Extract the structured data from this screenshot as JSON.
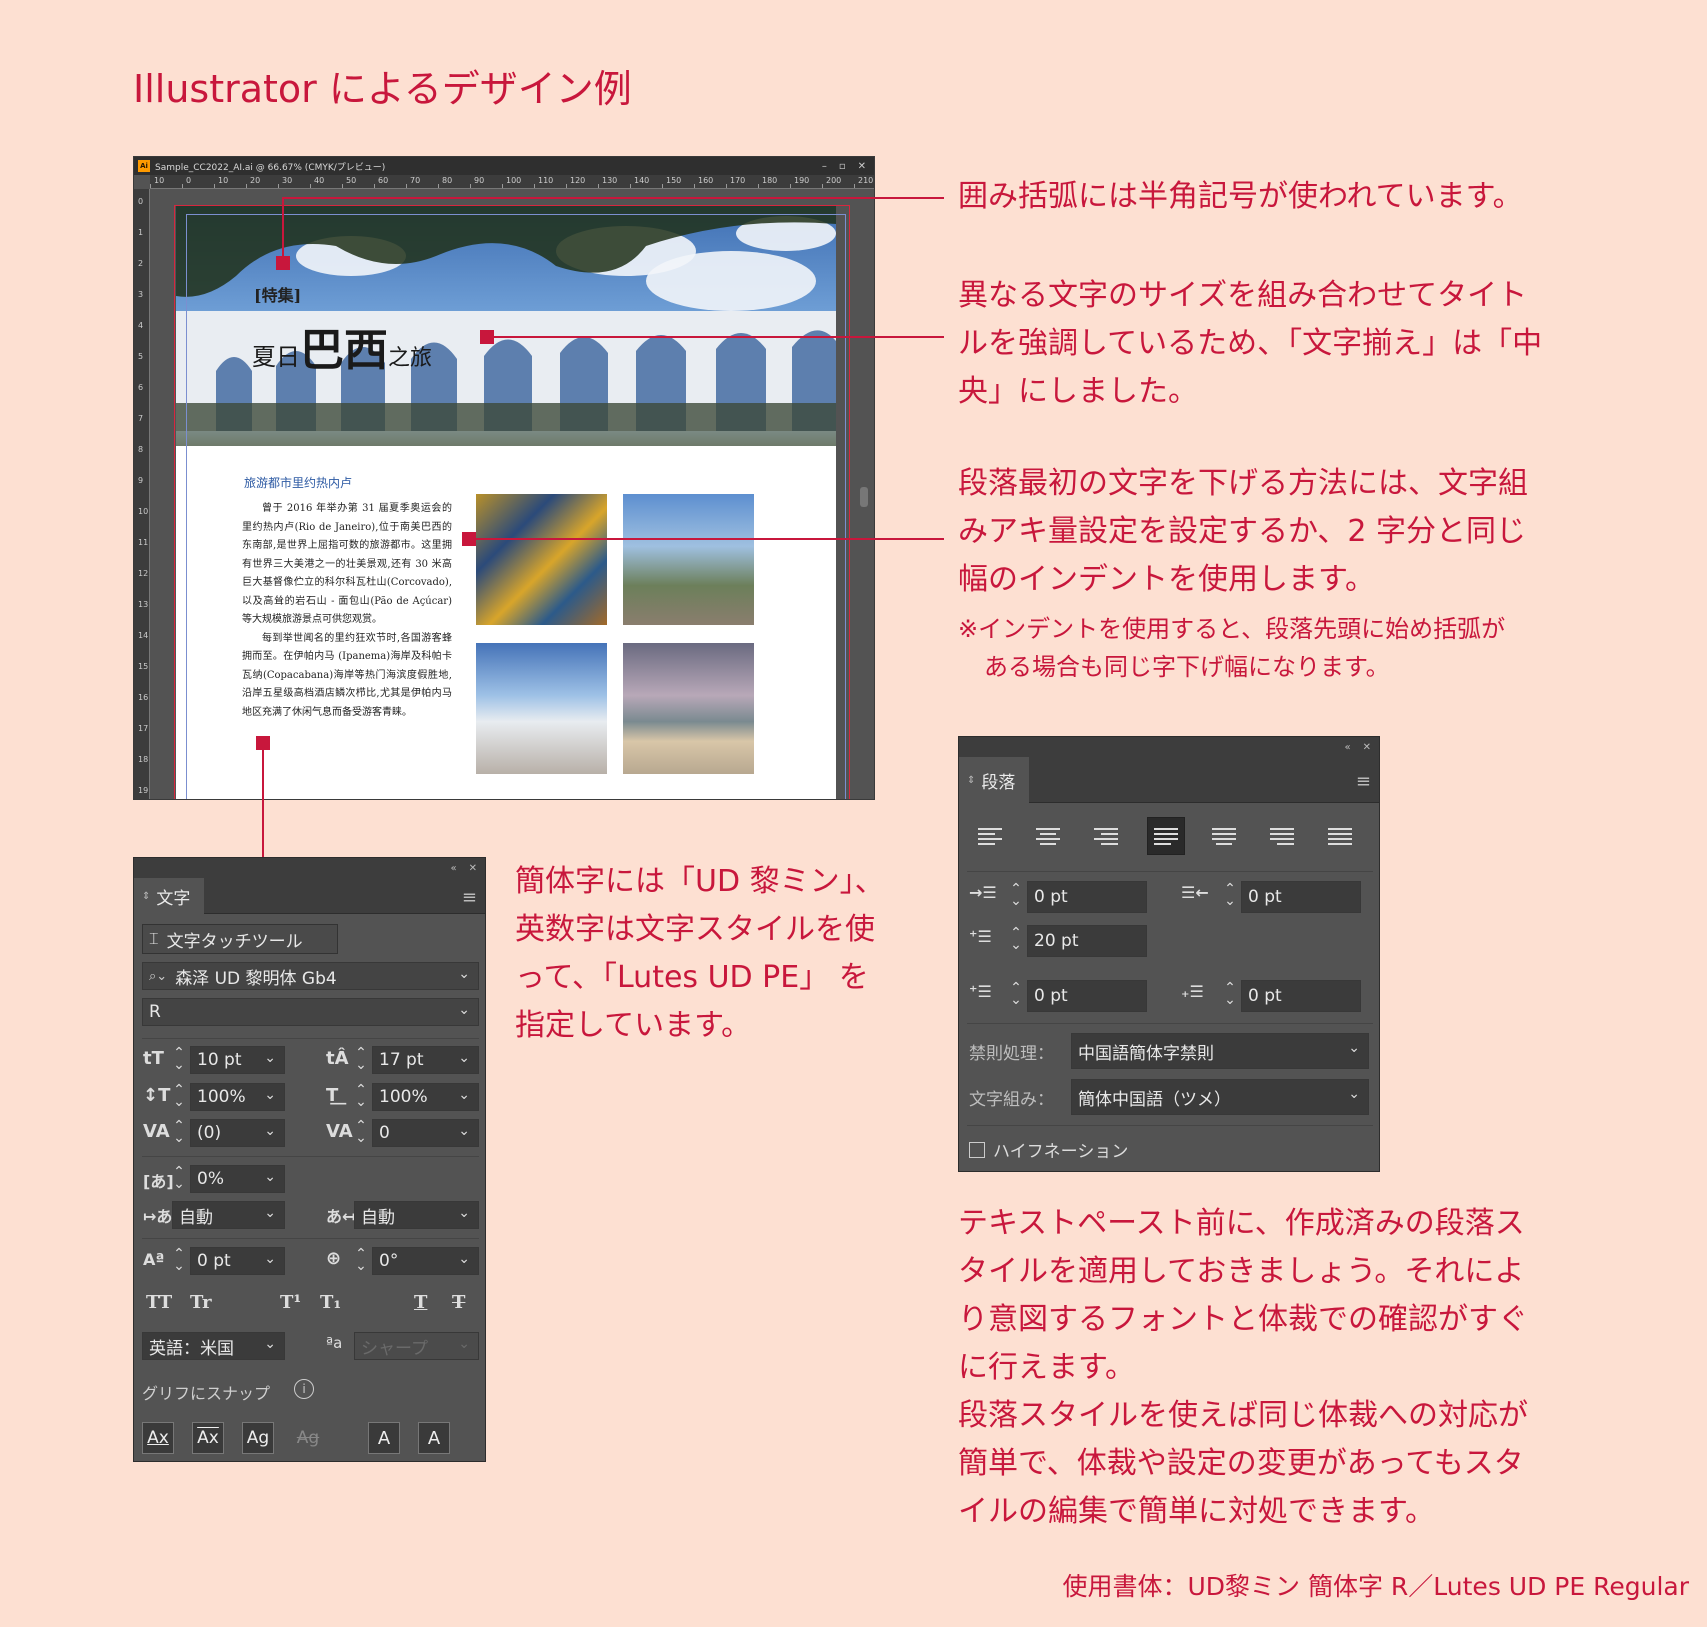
{
  "page": {
    "title": "Illustrator によるデザイン例",
    "footer": "使用書体：UD黎ミン 簡体字 R／Lutes UD PE Regular"
  },
  "annotations": {
    "brackets": "囲み括弧には半角記号が使われています。",
    "alignment": [
      "異なる文字のサイズを組み合わせてタイト",
      "ルを強調しているため、「文字揃え」は「中",
      "央」にしました。"
    ],
    "indent": [
      "段落最初の文字を下げる方法には、文字組",
      "みアキ量設定を設定するか、2 字分と同じ",
      "幅のインデントを使用します。"
    ],
    "indent_note": [
      "※インデントを使用すると、段落先頭に始め括弧が",
      "ある場合も同じ字下げ幅になります。"
    ],
    "fonts": [
      "簡体字には「UD 黎ミン」、",
      "英数字は文字スタイルを使",
      "って、「Lutes UD PE」 を",
      "指定しています。"
    ],
    "styles": [
      "テキストペースト前に、作成済みの段落ス",
      "タイルを適用しておきましょう。それによ",
      "り意図するフォントと体裁での確認がすぐ",
      "に行えます。",
      "段落スタイルを使えば同じ体裁への対応が",
      "簡単で、体裁や設定の変更があってもスタ",
      "イルの編集で簡単に対処できます。"
    ]
  },
  "illustrator": {
    "window_title": "Sample_CC2022_AI.ai @ 66.67% (CMYK/プレビュー)",
    "app_icon": "Ai",
    "ruler_top": [
      "10",
      "0",
      "10",
      "20",
      "30",
      "40",
      "50",
      "60",
      "70",
      "80",
      "90",
      "100",
      "110",
      "120",
      "130",
      "140",
      "150",
      "160",
      "170",
      "180",
      "190",
      "200",
      "210"
    ],
    "ruler_left": [
      "0",
      "1",
      "2",
      "3",
      "4",
      "5",
      "6",
      "7",
      "8",
      "9",
      "10",
      "11",
      "12",
      "13",
      "14",
      "15",
      "16",
      "17",
      "18",
      "19"
    ],
    "document": {
      "label": "[特集]",
      "title_a": "夏日",
      "title_b": "巴西",
      "title_c": "之旅",
      "heading": "旅游都市里约热内卢",
      "paragraphs": [
        "曾于 2016 年举办第 31 届夏季奥运会的里约热内卢(Rio de Janeiro),位于南美巴西的东南部,是世界上屈指可数的旅游都市。这里拥有世界三大美港之一的壮美景观,还有 30 米高巨大基督像伫立的科尔科瓦杜山(Corcovado),以及高耸的岩石山 - 面包山(Pão de Açúcar)等大规模旅游景点可供您观赏。",
        "每到举世闻名的里约狂欢节时,各国游客蜂拥而至。在伊帕内马 (Ipanema)海岸及科帕卡瓦纳(Copacabana)海岸等热门海滨度假胜地,沿岸五星级高档酒店鳞次栉比,尤其是伊帕内马地区充满了休闲气息而备受游客青睐。"
      ]
    }
  },
  "character_panel": {
    "tab": "文字",
    "tool_button": "文字タッチツール",
    "font_family": "森泽 UD 黎明体 Gb4",
    "font_style": "R",
    "font_size": "10 pt",
    "leading": "17 pt",
    "vertical_scale": "100%",
    "horizontal_scale": "100%",
    "kerning": "(0)",
    "tracking": "0",
    "tsume": "0%",
    "aki_before": "自動",
    "aki_after": "自動",
    "baseline_shift": "0 pt",
    "rotation": "0°",
    "caps_all": "TT",
    "caps_small": "Tr",
    "superscript": "T¹",
    "subscript": "T₁",
    "underline": "T",
    "strike": "T",
    "language": "英語：米国",
    "antialias": "シャープ",
    "aa_icon": "ªa",
    "snap_label": "グリフにスナップ",
    "info_icon": "i",
    "snap_icons": [
      "Ax",
      "Ax",
      "Ag",
      "Ag",
      "A",
      "A"
    ]
  },
  "paragraph_panel": {
    "tab": "段落",
    "left_indent": "0 pt",
    "right_indent": "0 pt",
    "first_line_indent": "20 pt",
    "space_before": "0 pt",
    "space_after": "0 pt",
    "kinsoku_label": "禁則処理：",
    "kinsoku_value": "中国語簡体字禁則",
    "mojikumi_label": "文字組み：",
    "mojikumi_value": "簡体中国語（ツメ）",
    "hyphenation_label": "ハイフネーション",
    "hyphenation_checked": false,
    "active_alignment": "justify-left"
  },
  "colors": {
    "accent": "#c8173c",
    "background": "#fde0d2",
    "panel": "#535353"
  }
}
